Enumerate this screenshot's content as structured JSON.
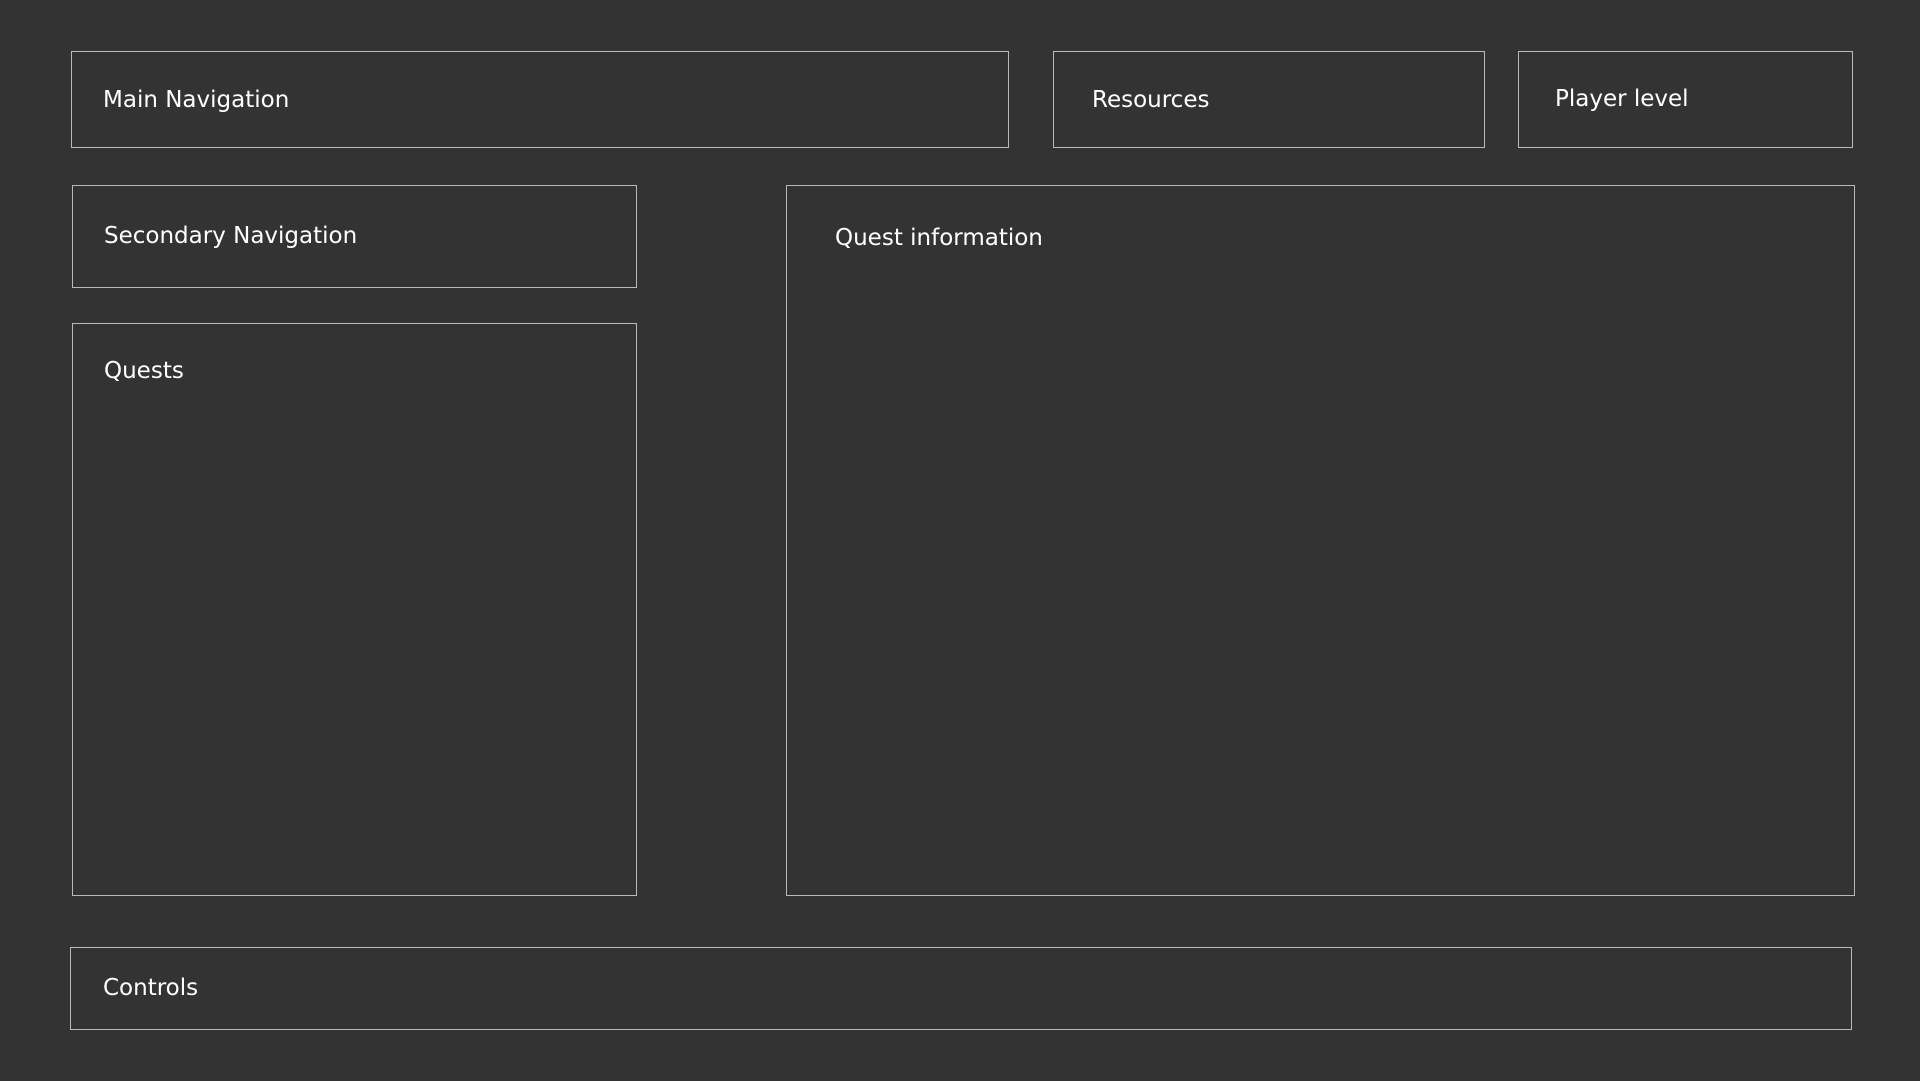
{
  "colors": {
    "background": "#333333",
    "panel_border": "#b9b9b9",
    "text": "#ffffff"
  },
  "main_navigation": {
    "label": "Main Navigation"
  },
  "resources": {
    "label": "Resources"
  },
  "player_level": {
    "label": "Player level"
  },
  "secondary_navigation": {
    "label": "Secondary Navigation"
  },
  "quests": {
    "label": "Quests"
  },
  "quest_information": {
    "label": "Quest information"
  },
  "controls": {
    "label": "Controls"
  }
}
